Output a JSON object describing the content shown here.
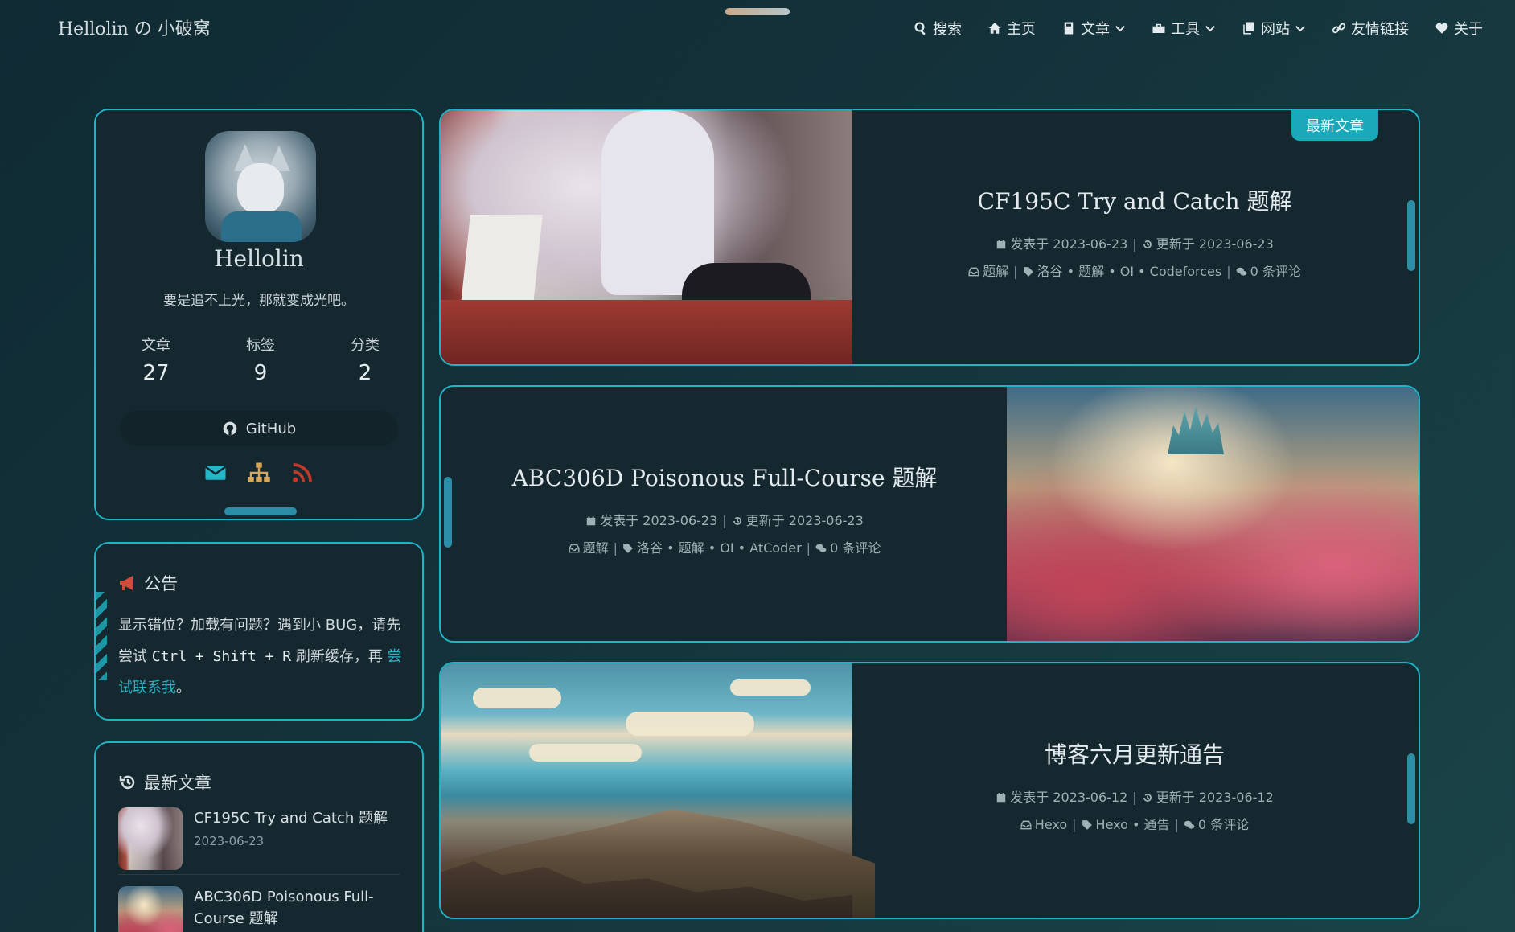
{
  "site": {
    "brand": "Hellolin の 小破窝"
  },
  "nav": [
    {
      "label": "搜索",
      "icon": "search-icon",
      "dropdown": false
    },
    {
      "label": "主页",
      "icon": "home-icon",
      "dropdown": false
    },
    {
      "label": "文章",
      "icon": "book-icon",
      "dropdown": true
    },
    {
      "label": "工具",
      "icon": "toolbox-icon",
      "dropdown": true
    },
    {
      "label": "网站",
      "icon": "copy-icon",
      "dropdown": true
    },
    {
      "label": "友情链接",
      "icon": "link-icon",
      "dropdown": false
    },
    {
      "label": "关于",
      "icon": "heart-icon",
      "dropdown": false
    }
  ],
  "profile": {
    "name": "Hellolin",
    "motto": "要是追不上光，那就变成光吧。",
    "stats": [
      {
        "label": "文章",
        "value": "27"
      },
      {
        "label": "标签",
        "value": "9"
      },
      {
        "label": "分类",
        "value": "2"
      }
    ],
    "github_label": "GitHub",
    "social": [
      "envelope-icon",
      "sitemap-icon",
      "rss-icon"
    ]
  },
  "notice": {
    "title": "公告",
    "text_1": "显示错位？加载有问题？遇到小 BUG，请先尝试 ",
    "code": "Ctrl + Shift + R",
    "text_2": " 刷新缓存，再 ",
    "link": "尝试联系我",
    "text_3": "。"
  },
  "latest": {
    "title": "最新文章",
    "items": [
      {
        "title": "CF195C Try and Catch 题解",
        "date": "2023-06-23"
      },
      {
        "title": "ABC306D Poisonous Full-Course 题解",
        "date": ""
      }
    ]
  },
  "posts": [
    {
      "badge": "最新文章",
      "title": "CF195C Try and Catch 题解",
      "posted": "发表于 2023-06-23",
      "updated": "更新于 2023-06-23",
      "category": "题解",
      "tags": "洛谷 • 题解 • OI • Codeforces",
      "comments": "0 条评论"
    },
    {
      "title": "ABC306D Poisonous Full-Course 题解",
      "posted": "发表于 2023-06-23",
      "updated": "更新于 2023-06-23",
      "category": "题解",
      "tags": "洛谷 • 题解 • OI • AtCoder",
      "comments": "0 条评论"
    },
    {
      "title": "博客六月更新通告",
      "posted": "发表于 2023-06-12",
      "updated": "更新于 2023-06-12",
      "category": "Hexo",
      "tags": "Hexo • 通告",
      "comments": "0 条评论"
    }
  ],
  "colors": {
    "accent": "#1fb3c4",
    "background": "#14313a",
    "card": "#15272f",
    "rss": "#c0392b"
  }
}
